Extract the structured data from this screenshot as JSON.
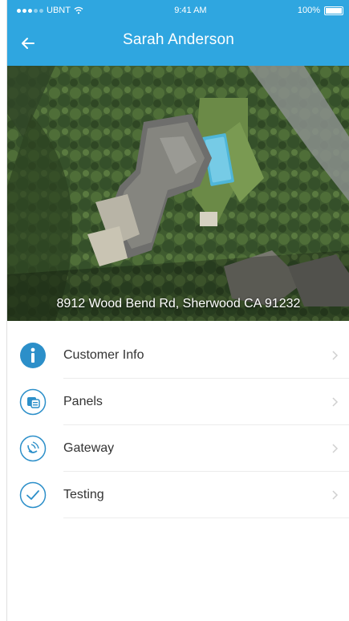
{
  "status_bar": {
    "carrier": "UBNT",
    "time": "9:41 AM",
    "battery": "100%"
  },
  "nav": {
    "title": "Sarah Anderson"
  },
  "hero": {
    "address": "8912 Wood Bend Rd, Sherwood CA 91232"
  },
  "menu": {
    "items": [
      {
        "label": "Customer Info",
        "icon": "info-icon"
      },
      {
        "label": "Panels",
        "icon": "panels-icon"
      },
      {
        "label": "Gateway",
        "icon": "gateway-icon"
      },
      {
        "label": "Testing",
        "icon": "check-icon"
      }
    ]
  },
  "colors": {
    "accent": "#2fa6e0",
    "icon_stroke": "#2c8fc9"
  }
}
